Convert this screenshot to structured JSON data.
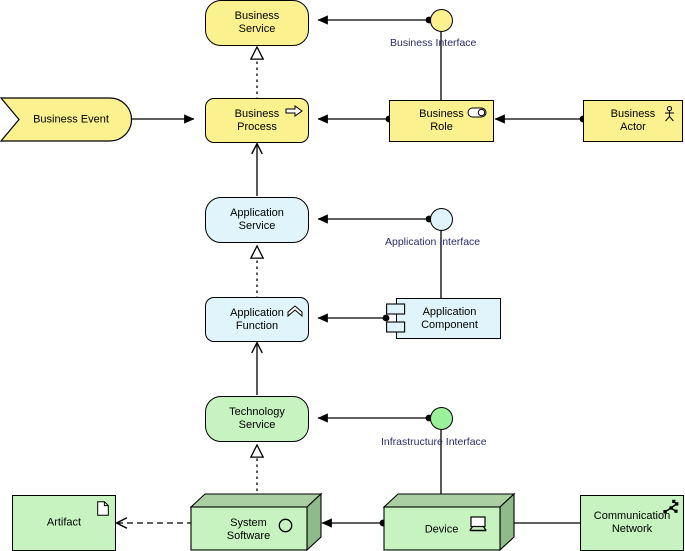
{
  "diagram": {
    "title": "ArchiMate core framework example",
    "colors": {
      "business_fill": "#fbf18e",
      "application_fill": "#dff5fb",
      "technology_fill": "#c6f3c0",
      "stroke": "#000000",
      "label_text": "#2a2a6a",
      "node_text": "#000000",
      "box_3d_top": "#a9cfa3",
      "box_3d_side": "#8fba89"
    }
  },
  "nodes": {
    "business_service": {
      "label": "Business\nService",
      "layer": "business",
      "shape": "rounded",
      "icon": "none"
    },
    "business_interface": {
      "label": "Business Interface",
      "layer": "business",
      "shape": "circle",
      "icon": "interface-circle-icon"
    },
    "business_event": {
      "label": "Business Event",
      "layer": "business",
      "shape": "pennant",
      "icon": "none"
    },
    "business_process": {
      "label": "Business\nProcess",
      "layer": "business",
      "shape": "rounded",
      "icon": "arrow-icon"
    },
    "business_role": {
      "label": "Business\nRole",
      "layer": "business",
      "shape": "rect",
      "icon": "role-cylinder-icon"
    },
    "business_actor": {
      "label": "Business\nActor",
      "layer": "business",
      "shape": "rect",
      "icon": "actor-stick-figure-icon"
    },
    "application_service": {
      "label": "Application\nService",
      "layer": "application",
      "shape": "rounded",
      "icon": "none"
    },
    "application_interface": {
      "label": "Application Interface",
      "layer": "application",
      "shape": "circle",
      "icon": "interface-circle-icon"
    },
    "application_function": {
      "label": "Application\nFunction",
      "layer": "application",
      "shape": "rounded",
      "icon": "function-chevron-icon"
    },
    "application_component": {
      "label": "Application\nComponent",
      "layer": "application",
      "shape": "component",
      "icon": "component-tabs-icon"
    },
    "technology_service": {
      "label": "Technology\nService",
      "layer": "technology",
      "shape": "rounded",
      "icon": "none"
    },
    "infrastructure_interface": {
      "label": "Infrastructure Interface",
      "layer": "technology",
      "shape": "circle",
      "icon": "interface-circle-icon"
    },
    "artifact": {
      "label": "Artifact",
      "layer": "technology",
      "shape": "rect",
      "icon": "document-icon"
    },
    "system_software": {
      "label": "System\nSoftware",
      "layer": "technology",
      "shape": "box3d",
      "icon": "circle-icon"
    },
    "device": {
      "label": "Device",
      "layer": "technology",
      "shape": "box3d",
      "icon": "monitor-icon"
    },
    "communication_network": {
      "label": "Communication\nNetwork",
      "layer": "technology",
      "shape": "rect",
      "icon": "network-icon"
    }
  },
  "relationships": [
    {
      "from": "business_interface",
      "to": "business_service",
      "type": "assignment"
    },
    {
      "from": "business_process",
      "to": "business_service",
      "type": "realization"
    },
    {
      "from": "business_event",
      "to": "business_process",
      "type": "triggering"
    },
    {
      "from": "business_role",
      "to": "business_process",
      "type": "assignment"
    },
    {
      "from": "business_actor",
      "to": "business_role",
      "type": "assignment"
    },
    {
      "from": "business_role",
      "to": "business_interface",
      "type": "composition"
    },
    {
      "from": "application_service",
      "to": "business_process",
      "type": "serving"
    },
    {
      "from": "application_interface",
      "to": "application_service",
      "type": "assignment"
    },
    {
      "from": "application_function",
      "to": "application_service",
      "type": "realization"
    },
    {
      "from": "application_component",
      "to": "application_function",
      "type": "assignment"
    },
    {
      "from": "application_component",
      "to": "application_interface",
      "type": "composition"
    },
    {
      "from": "technology_service",
      "to": "application_function",
      "type": "serving"
    },
    {
      "from": "infrastructure_interface",
      "to": "technology_service",
      "type": "assignment"
    },
    {
      "from": "system_software",
      "to": "technology_service",
      "type": "realization"
    },
    {
      "from": "device",
      "to": "system_software",
      "type": "assignment"
    },
    {
      "from": "device",
      "to": "infrastructure_interface",
      "type": "composition"
    },
    {
      "from": "artifact",
      "to": "system_software",
      "type": "association-bidirectional"
    },
    {
      "from": "device",
      "to": "communication_network",
      "type": "association"
    }
  ]
}
